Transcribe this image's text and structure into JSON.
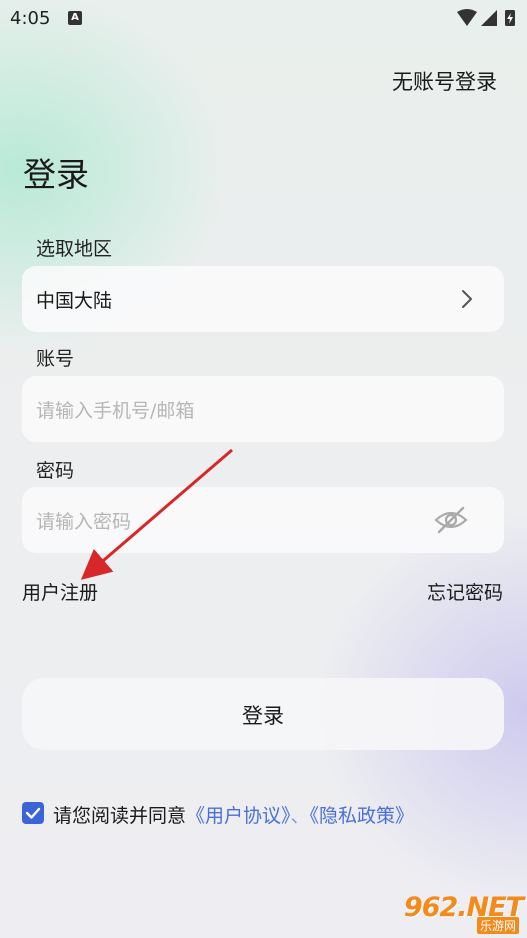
{
  "status_bar": {
    "time": "4:05",
    "notification_badge": "A"
  },
  "header": {
    "no_account_login": "无账号登录"
  },
  "page": {
    "title": "登录"
  },
  "region": {
    "label": "选取地区",
    "value": "中国大陆"
  },
  "account": {
    "label": "账号",
    "placeholder": "请输入手机号/邮箱"
  },
  "password": {
    "label": "密码",
    "placeholder": "请输入密码"
  },
  "links": {
    "register": "用户注册",
    "forgot_password": "忘记密码"
  },
  "login_button": {
    "label": "登录"
  },
  "agreement": {
    "checked": true,
    "prefix": "请您阅读并同意",
    "user_agreement": "《用户协议》",
    "separator": "、",
    "privacy_policy": "《隐私政策》"
  },
  "watermark": {
    "brand": "962.NET",
    "sub": "乐游网"
  },
  "colors": {
    "accent": "#3b64d9",
    "link": "#4a70d8",
    "annotation_arrow": "#d62828"
  }
}
